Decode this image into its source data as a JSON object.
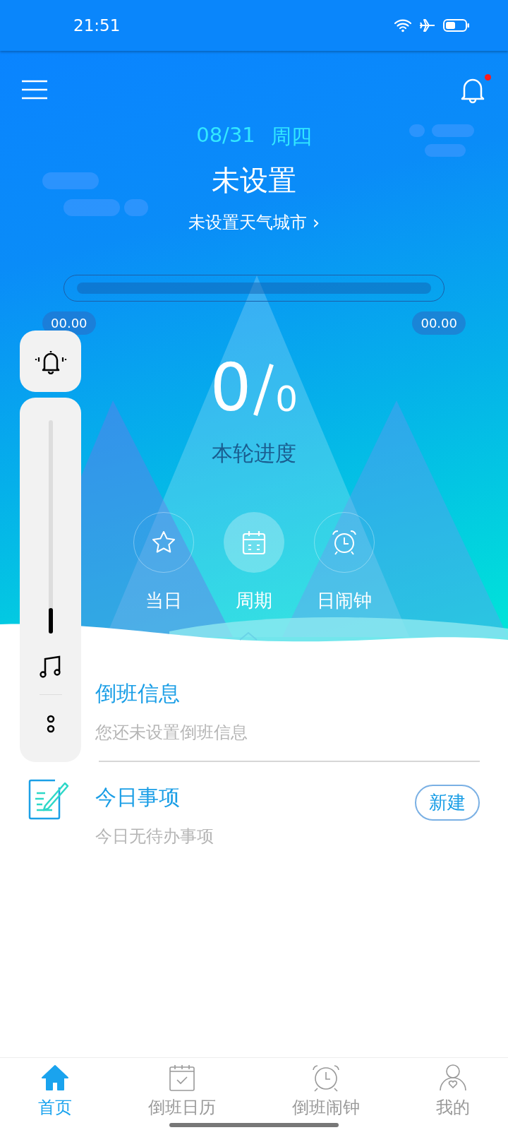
{
  "status_bar": {
    "time": "21:51"
  },
  "header": {
    "notifications_unread": true,
    "date": "08/31",
    "weekday": "周四",
    "title": "未设置",
    "city_link": "未设置天气城市",
    "city_chevron": "›"
  },
  "progress": {
    "start_time": "00.00",
    "end_time": "00.00",
    "count": "0",
    "total": "0",
    "caption": "本轮进度"
  },
  "modes": [
    {
      "kind": "star",
      "label": "当日",
      "selected": false
    },
    {
      "kind": "calendar",
      "label": "周期",
      "selected": true
    },
    {
      "kind": "alarm",
      "label": "日闹钟",
      "selected": false
    }
  ],
  "volume_panel": {
    "level": 0.12
  },
  "shift_info": {
    "title": "倒班信息",
    "subtitle": "您还未设置倒班信息"
  },
  "today": {
    "title": "今日事项",
    "subtitle": "今日无待办事项",
    "button": "新建"
  },
  "nav": [
    {
      "kind": "home",
      "label": "首页",
      "selected": true
    },
    {
      "kind": "calendar",
      "label": "倒班日历",
      "selected": false
    },
    {
      "kind": "alarm",
      "label": "倒班闹钟",
      "selected": false
    },
    {
      "kind": "user",
      "label": "我的",
      "selected": false
    }
  ]
}
